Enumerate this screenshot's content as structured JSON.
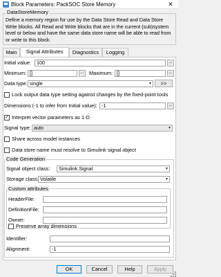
{
  "window": {
    "title": "Block Parameters: PackSOC Store Memory",
    "close_glyph": "✕"
  },
  "description": {
    "group_title": "DataStoreMemory",
    "text": "Define a memory region for use by the Data Store Read and Data Store Write blocks. All Read and Write blocks that are in the current (sub)system level or below and have the same data store name will be able to read from or write to this block."
  },
  "tabs": [
    "Main",
    "Signal Attributes",
    "Diagnostics",
    "Logging"
  ],
  "active_tab": "Signal Attributes",
  "fields": {
    "initial_value": {
      "label": "Initial value:",
      "value": "100"
    },
    "minimum": {
      "label": "Minimum:",
      "value": "[]"
    },
    "maximum": {
      "label": "Maximum:",
      "value": "[]"
    },
    "data_type": {
      "label": "Data type:",
      "value": "single",
      "assistant_button": ">>"
    },
    "lock_output": {
      "label": "Lock output data type setting against changes by the fixed-point tools",
      "checked": false
    },
    "dimensions": {
      "label": "Dimensions (-1 to infer from Initial value):",
      "value": "-1"
    },
    "interpret_vector": {
      "label": "Interpret vector parameters as 1-D",
      "checked": true
    },
    "signal_type": {
      "label": "Signal type:",
      "value": "auto"
    },
    "share_instances": {
      "label": "Share across model instances",
      "checked": false
    },
    "resolve_signal": {
      "label": "Data store name must resolve to Simulink signal object",
      "checked": false
    }
  },
  "code_generation": {
    "group_title": "Code Generation",
    "signal_object_class": {
      "label": "Signal object class:",
      "value": "Simulink.Signal"
    },
    "storage_class": {
      "label": "Storage class:",
      "value": "Volatile"
    },
    "custom_attributes": {
      "group_title": "Custom attributes",
      "header_file": {
        "label": "HeaderFile:",
        "value": ""
      },
      "definition_file": {
        "label": "DefinitionFile:",
        "value": ""
      },
      "owner": {
        "label": "Owner:",
        "value": ""
      },
      "preserve_dims": {
        "label": "Preserve array dimensions",
        "checked": false
      }
    },
    "identifier": {
      "label": "Identifier:",
      "value": ""
    },
    "alignment": {
      "label": "Alignment:",
      "value": "-1"
    }
  },
  "buttons": {
    "ok": "OK",
    "cancel": "Cancel",
    "help": "Help",
    "apply": "Apply"
  },
  "glyphs": {
    "ellipsis": "...",
    "check": "✓",
    "dropdown": "▾"
  },
  "colors": {
    "focus_border": "#0078d7",
    "panel_bg": "#ffffff",
    "window_bg": "#f0f0f0"
  }
}
